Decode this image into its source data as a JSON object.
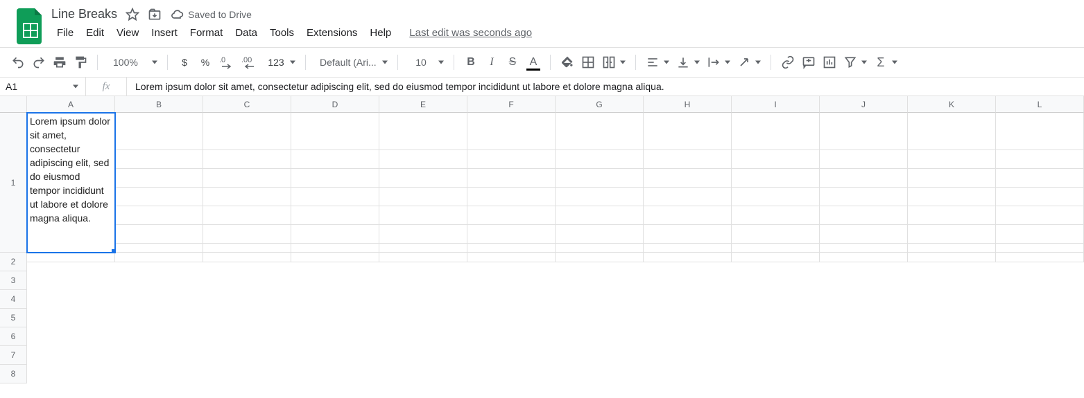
{
  "header": {
    "doc_title": "Line Breaks",
    "save_status": "Saved to Drive",
    "last_edit": "Last edit was seconds ago"
  },
  "menu": {
    "file": "File",
    "edit": "Edit",
    "view": "View",
    "insert": "Insert",
    "format": "Format",
    "data": "Data",
    "tools": "Tools",
    "extensions": "Extensions",
    "help": "Help"
  },
  "toolbar": {
    "zoom": "100%",
    "currency": "$",
    "percent": "%",
    "dec_decrease": ".0",
    "dec_increase": ".00",
    "num_format": "123",
    "font": "Default (Ari...",
    "font_size": "10"
  },
  "namebox": {
    "cell_ref": "A1",
    "fx_label": "fx",
    "formula": "Lorem ipsum dolor sit amet, consectetur adipiscing elit, sed do eiusmod tempor incididunt ut labore et dolore magna aliqua."
  },
  "grid": {
    "cols": [
      "A",
      "B",
      "C",
      "D",
      "E",
      "F",
      "G",
      "H",
      "I",
      "J",
      "K",
      "L"
    ],
    "rows": [
      "1",
      "2",
      "3",
      "4",
      "5",
      "6",
      "7",
      "8"
    ],
    "a1_content": "Lorem ipsum dolor sit amet, consectetur adipiscing elit, sed do eiusmod tempor incididunt ut labore et dolore magna aliqua."
  }
}
